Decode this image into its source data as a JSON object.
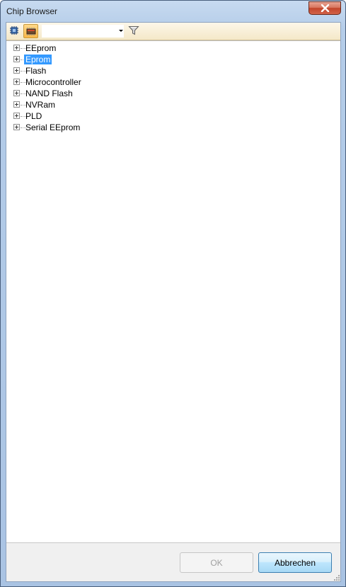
{
  "window": {
    "title": "Chip Browser"
  },
  "toolbar": {
    "combo_value": ""
  },
  "tree": {
    "items": [
      {
        "label": "EEprom",
        "selected": false
      },
      {
        "label": "Eprom",
        "selected": true
      },
      {
        "label": "Flash",
        "selected": false
      },
      {
        "label": "Microcontroller",
        "selected": false
      },
      {
        "label": "NAND Flash",
        "selected": false
      },
      {
        "label": "NVRam",
        "selected": false
      },
      {
        "label": "PLD",
        "selected": false
      },
      {
        "label": "Serial EEprom",
        "selected": false
      }
    ]
  },
  "footer": {
    "ok_label": "OK",
    "cancel_label": "Abbrechen"
  },
  "colors": {
    "selection": "#3399ff",
    "close_button": "#c2452b",
    "toolbar_bg": "#f4e8c8"
  },
  "icons": {
    "close": "close-icon",
    "chip_view": "chip-tree-icon",
    "package_view": "chip-package-icon",
    "filter": "filter-icon",
    "combo_arrow": "dropdown-arrow-icon"
  }
}
